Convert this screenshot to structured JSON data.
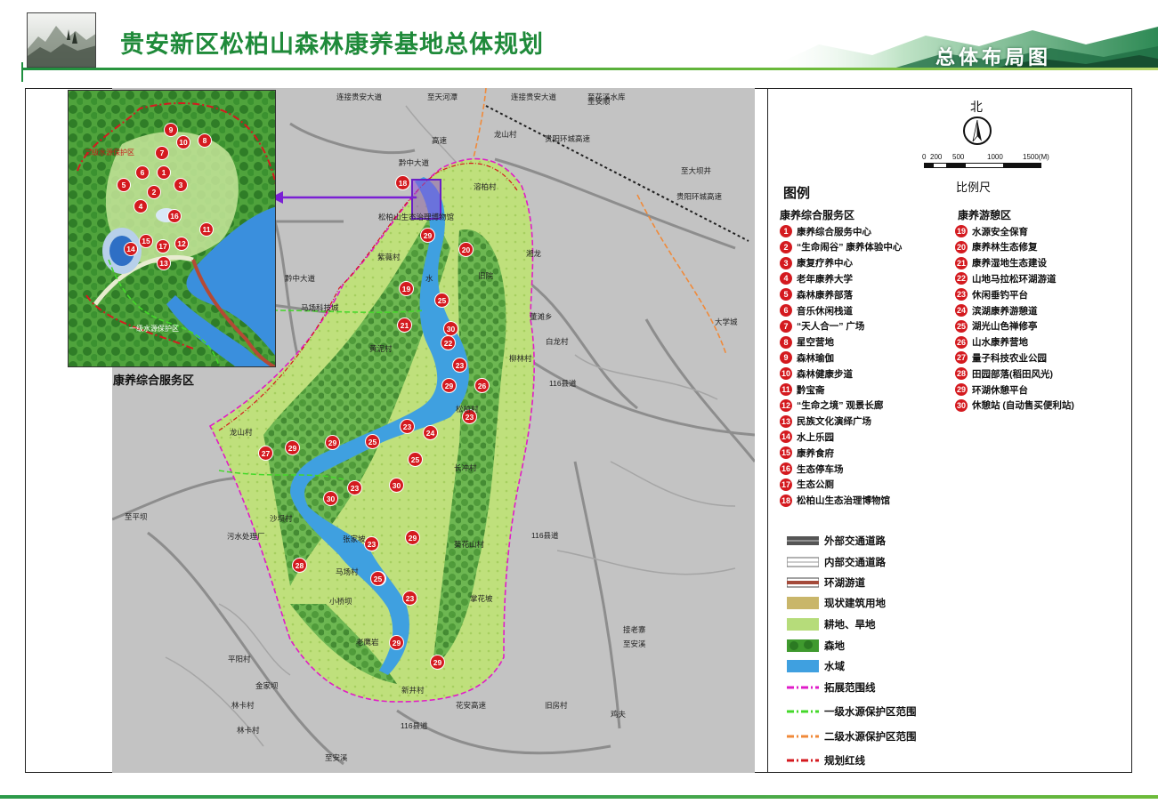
{
  "header": {
    "title": "贵安新区松柏山森林康养基地总体规划",
    "banner_title": "总体布局图"
  },
  "north": {
    "label": "北"
  },
  "scale": {
    "ticks": [
      "0",
      "200",
      "500",
      "1000",
      "1500(M)"
    ],
    "caption": "比例尺"
  },
  "legend": {
    "title": "图例",
    "group_service": {
      "title": "康养综合服务区",
      "items": [
        {
          "num": "1",
          "label": "康养综合服务中心"
        },
        {
          "num": "2",
          "label": "“生命闹谷” 康养体验中心"
        },
        {
          "num": "3",
          "label": "康复疗养中心"
        },
        {
          "num": "4",
          "label": "老年康养大学"
        },
        {
          "num": "5",
          "label": "森林康养部落"
        },
        {
          "num": "6",
          "label": "音乐休闲栈道"
        },
        {
          "num": "7",
          "label": "“天人合一” 广场"
        },
        {
          "num": "8",
          "label": "星空营地"
        },
        {
          "num": "9",
          "label": "森林瑜伽"
        },
        {
          "num": "10",
          "label": "森林健康步道"
        },
        {
          "num": "11",
          "label": "黔宝斋"
        },
        {
          "num": "12",
          "label": "“生命之境” 观景长廊"
        },
        {
          "num": "13",
          "label": "民族文化演绎广场"
        },
        {
          "num": "14",
          "label": "水上乐园"
        },
        {
          "num": "15",
          "label": "康养食府"
        },
        {
          "num": "16",
          "label": "生态停车场"
        },
        {
          "num": "17",
          "label": "生态公厕"
        },
        {
          "num": "18",
          "label": "松柏山生态治理博物馆"
        }
      ]
    },
    "group_leisure": {
      "title": "康养游憩区",
      "items": [
        {
          "num": "19",
          "label": "水源安全保育"
        },
        {
          "num": "20",
          "label": "康养林生态修复"
        },
        {
          "num": "21",
          "label": "康养湿地生态建设"
        },
        {
          "num": "22",
          "label": "山地马拉松环湖游道"
        },
        {
          "num": "23",
          "label": "休闲垂钓平台"
        },
        {
          "num": "24",
          "label": "滨湖康养游憩道"
        },
        {
          "num": "25",
          "label": "湖光山色禅修亭"
        },
        {
          "num": "26",
          "label": "山水康养营地"
        },
        {
          "num": "27",
          "label": "量子科技农业公园"
        },
        {
          "num": "28",
          "label": "田园部落(稻田风光)"
        },
        {
          "num": "29",
          "label": "环湖休憩平台"
        },
        {
          "num": "30",
          "label": "休憩站 (自动售买便利站)"
        }
      ]
    },
    "keys": [
      {
        "label": "外部交通道路",
        "type": "road-outer"
      },
      {
        "label": "内部交通道路",
        "type": "road-inner"
      },
      {
        "label": "环湖游道",
        "type": "lake-path"
      },
      {
        "label": "现状建筑用地",
        "type": "building"
      },
      {
        "label": "耕地、旱地",
        "type": "farmland"
      },
      {
        "label": "森地",
        "type": "forest"
      },
      {
        "label": "水域",
        "type": "water"
      },
      {
        "label": "拓展范围线",
        "type": "line-magenta"
      },
      {
        "label": "一级水源保护区范围",
        "type": "line-green"
      },
      {
        "label": "二级水源保护区范围",
        "type": "line-orange"
      },
      {
        "label": "规划红线",
        "type": "line-red"
      }
    ],
    "colors": {
      "badge": "#d41a1f",
      "water": "#3fa0e0",
      "forest": "#3f9a2e",
      "farmland": "#b6dc7a",
      "building": "#c9b66a",
      "magenta": "#e01cc8",
      "green_line": "#44d82a",
      "orange_line": "#f08a3a",
      "red_line": "#d41a1f"
    }
  },
  "inset": {
    "caption": "康养综合服务区",
    "labels": [
      "三级水源保护区",
      "一级水源保护区"
    ],
    "markers": [
      "1",
      "2",
      "3",
      "4",
      "5",
      "6",
      "7",
      "8",
      "9",
      "10",
      "11",
      "12",
      "13",
      "14",
      "15",
      "16",
      "17"
    ]
  },
  "map": {
    "place_labels": [
      "连接贵安大道",
      "至天河潭",
      "连接贵安大道",
      "至花溪水库",
      "高速",
      "龙山村",
      "黔中大道",
      "溶柏村",
      "至大坝井",
      "贵阳环城高速",
      "松柏山生态治理博物馆",
      "贵阳环城高速",
      "黔中大道",
      "紫薇村",
      "旧院",
      "马场科技城",
      "水",
      "湘龙",
      "董滩乡",
      "白龙村",
      "大学城",
      "黄泥村",
      "柳林村",
      "松柏村",
      "116县道",
      "龙山村",
      "长冲村",
      "沙坝村",
      "葵花山村",
      "张家坡",
      "至平坝",
      "污水处理厂",
      "116县道",
      "马场村",
      "小桥坝",
      "老鹰岩",
      "掌花坡",
      "平阳村",
      "金家坝",
      "接老寨",
      "至安溪",
      "新井村",
      "旧房村",
      "林卡村",
      "林卡村",
      "116县道",
      "花安高速",
      "至安溪",
      "鸡夫",
      "至安顺"
    ],
    "markers": [
      "18",
      "29",
      "20",
      "19",
      "25",
      "21",
      "30",
      "22",
      "23",
      "29",
      "26",
      "23",
      "24",
      "23",
      "25",
      "29",
      "27",
      "29",
      "25",
      "25",
      "23",
      "30",
      "30",
      "23",
      "29",
      "28",
      "25",
      "23",
      "29",
      "29"
    ]
  }
}
